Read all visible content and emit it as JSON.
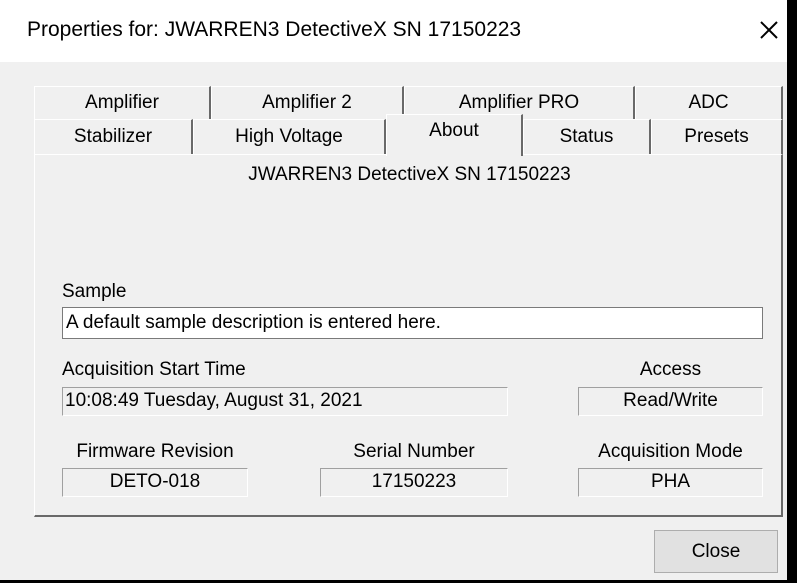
{
  "window": {
    "title": "Properties for: JWARREN3 DetectiveX SN 17150223",
    "close_glyph": "✕"
  },
  "tabs": {
    "row1": [
      "Amplifier",
      "Amplifier 2",
      "Amplifier PRO",
      "ADC"
    ],
    "row2": [
      "Stabilizer",
      "High Voltage",
      "About",
      "Status",
      "Presets"
    ],
    "active": "About"
  },
  "about": {
    "device_name": "JWARREN3 DetectiveX SN 17150223",
    "sample_label": "Sample",
    "sample_value": "A default sample description is entered here.",
    "acq_start_label": "Acquisition Start Time",
    "acq_start_value": "10:08:49 Tuesday, August 31, 2021",
    "access_label": "Access",
    "access_value": "Read/Write",
    "firmware_label": "Firmware Revision",
    "firmware_value": "DETO-018",
    "serial_label": "Serial Number",
    "serial_value": "17150223",
    "acq_mode_label": "Acquisition Mode",
    "acq_mode_value": "PHA"
  },
  "buttons": {
    "close": "Close"
  }
}
